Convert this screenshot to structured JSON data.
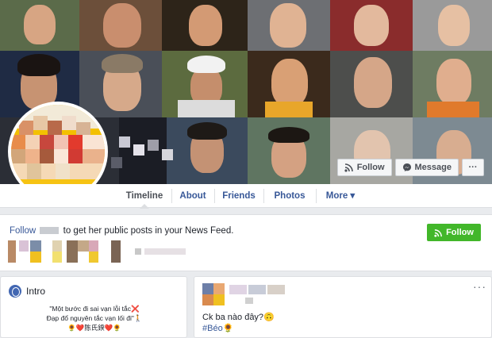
{
  "cover": {
    "follow_label": "Follow",
    "message_label": "Message",
    "more_label": "···"
  },
  "tabs": [
    {
      "label": "Timeline"
    },
    {
      "label": "About"
    },
    {
      "label": "Friends"
    },
    {
      "label": "Photos"
    },
    {
      "label": "More ▾"
    }
  ],
  "follow_notice": {
    "link": "Follow",
    "text": "to get her public posts in your News Feed.",
    "button_label": "Follow"
  },
  "intro": {
    "title": "Intro",
    "line1": "\"Một bước đi sai vạn lỗi tắc❌",
    "line2": "Đạp đổ nguyên tắc vạn lối đi\"🚶",
    "line3": "🌻❤️陈氏鍨❤️🌻"
  },
  "post": {
    "text": "Ck ba nào đây?🙃",
    "hashtag": "#Béo🌻",
    "menu": "···"
  },
  "colors": {
    "link": "#385898",
    "green": "#42b72a",
    "fb_blue": "#4267b2"
  }
}
